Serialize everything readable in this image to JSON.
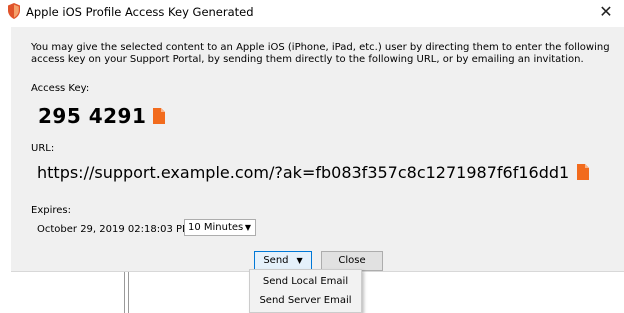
{
  "window": {
    "title": "Apple iOS Profile Access Key Generated",
    "close_glyph": "✕",
    "app_icon": "shield-icon"
  },
  "dialog": {
    "message": "You may give the selected content to an Apple iOS (iPhone, iPad, etc.) user by directing them to enter the following access key on your Support Portal, by sending them directly to the following URL, or by emailing an invitation.",
    "access_key_label": "Access Key:",
    "access_key": "295 4291",
    "url_label": "URL:",
    "url": "https://support.example.com/?ak=fb083f357c8c1271987f6f16dd1",
    "expires_label": "Expires:",
    "expires_date": "October 29, 2019 02:18:03 PM",
    "expires_duration": "10 Minutes",
    "copy_icon": "copy-icon",
    "accent_color": "#f26b1d"
  },
  "buttons": {
    "send_label": "Send",
    "send_arrow": "▼",
    "close_label": "Close",
    "select_arrow": "▼"
  },
  "send_menu": {
    "items": [
      {
        "label": "Send Local Email"
      },
      {
        "label": "Send Server Email"
      }
    ]
  }
}
